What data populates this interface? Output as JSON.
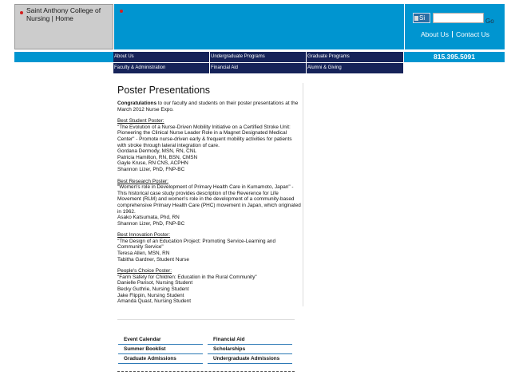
{
  "header": {
    "logo_text": "Saint Anthony College of Nursing | Home",
    "search_button": "Si",
    "search_placeholder": "",
    "go_label": "Go",
    "util_links": [
      "About Us",
      "Contact Us"
    ],
    "phone": "815.395.5091"
  },
  "nav": {
    "items": [
      "About Us",
      "Undergraduate Programs",
      "Graduate Programs",
      "Faculty & Administration",
      "Financial Aid",
      "Alumni & Giving"
    ]
  },
  "main": {
    "title": "Poster Presentations",
    "intro_bold": "Congratulations",
    "intro_rest": " to our faculty and students on their poster presentations at the March 2012 Nurse Expo.",
    "awards": [
      {
        "heading": "Best Student Poster:",
        "lines": [
          "\"The Evolution of a Nurse-Driven Mobility Initiative on a Certified Stroke Unit: Pioneering the Clinical Nurse Leader Role in a Magnet Designated Medical Center\" - Promote nurse-driven early & frequent mobility activities for patients with stroke through lateral integration of care.",
          "Gordana Dermody, MSN, RN, CNL",
          "Patricia Hamilton, RN, BSN, CMSN",
          "Gayle Kruse, RN CNS, ACPHN",
          "Shannon Lizer, PhD, FNP-BC"
        ]
      },
      {
        "heading": "Best Research Poster:",
        "lines": [
          "\"Women's role in Development of Primary Health Care in Kumamoto, Japan\" - This historical case study provides description of the Reverence for Life Movement (RLM) and women's role in the development of a community-based comprehensive Primary Health Care (PHC) movement in Japan, which originated in 1962.",
          "Asako Katsumata, Phd, RN",
          "Shannon Lizer, PhD, FNP-BC"
        ]
      },
      {
        "heading": "Best Innovation Poster:",
        "lines": [
          "\"The Design of an Education Project: Promoting Service-Learning and Community Service\"",
          "Teresa Allen, MSN, RN",
          "Tabitha Gardner, Student Nurse"
        ]
      },
      {
        "heading": "People's Choice Poster:",
        "lines": [
          "\"Farm Safety for Children: Education in the Rural Community\"",
          "Danielle Parisot, Nursing Student",
          "Becky Guthrie, Nursing Student",
          "Jake Flippin, Nursing Student",
          "Amanda Quast, Nursing Student"
        ]
      }
    ]
  },
  "footer": {
    "links": [
      "Event Calendar",
      "Financial Aid",
      "Summer Booklist",
      "Scholarships",
      "Graduate Admissions",
      "Undergraduate Admissions"
    ]
  },
  "colors": {
    "header_blue": "#0095d0",
    "nav_navy": "#162359",
    "accent_red": "#d42020"
  }
}
